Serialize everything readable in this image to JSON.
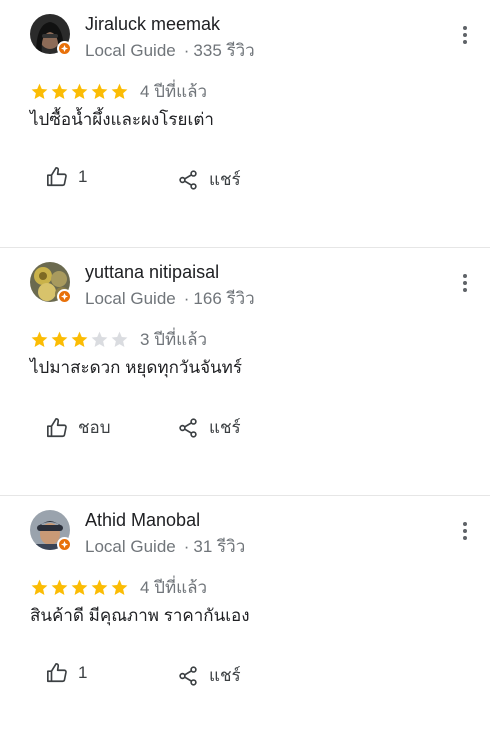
{
  "colors": {
    "star_filled": "#fbbc04",
    "star_empty": "#dadce0",
    "badge": "#e8710a"
  },
  "reviews": [
    {
      "name": "Jiraluck meemak",
      "guide_label": "Local Guide",
      "review_count": "335 รีวิว",
      "rating": 5,
      "time": "4 ปีที่แล้ว",
      "text": "ไปซื้อน้ำผึ้งและผงโรยเต่า",
      "like_label": "1",
      "share_label": "แชร์"
    },
    {
      "name": "yuttana nitipaisal",
      "guide_label": "Local Guide",
      "review_count": "166 รีวิว",
      "rating": 3,
      "time": "3 ปีที่แล้ว",
      "text": "ไปมาสะดวก หยุดทุกวันจันทร์",
      "like_label": "ชอบ",
      "share_label": "แชร์"
    },
    {
      "name": "Athid Manobal",
      "guide_label": "Local Guide",
      "review_count": "31 รีวิว",
      "rating": 5,
      "time": "4 ปีที่แล้ว",
      "text": "สินค้าดี มีคุณภาพ ราคากันเอง",
      "like_label": "1",
      "share_label": "แชร์"
    }
  ]
}
